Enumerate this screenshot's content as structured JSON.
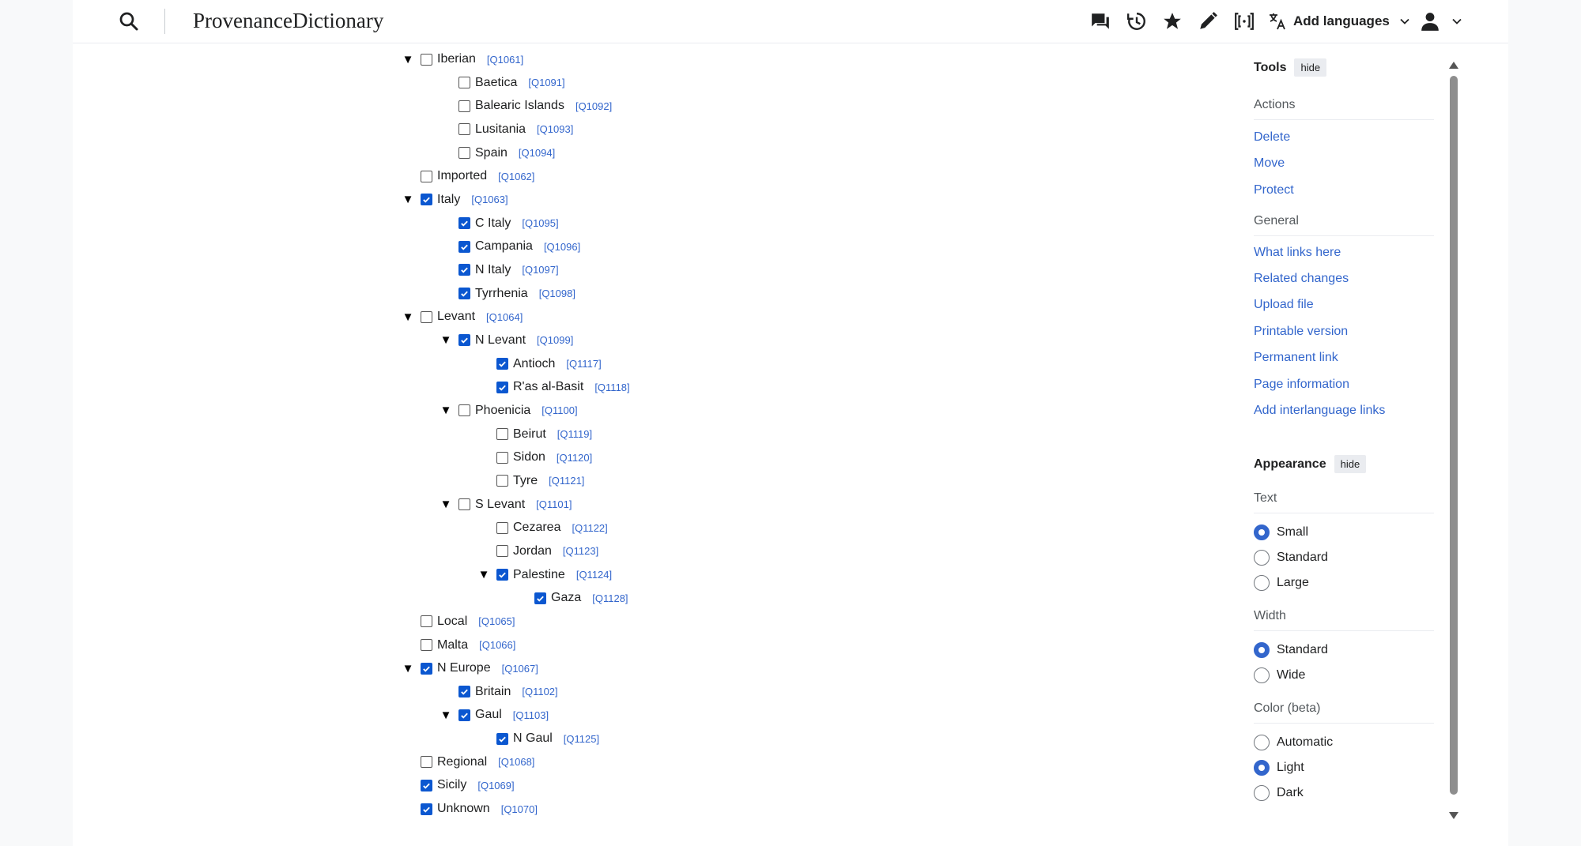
{
  "header": {
    "site_title": "ProvenanceDictionary",
    "add_languages": "Add languages",
    "icons": [
      "search-icon",
      "discussion-icon",
      "history-icon",
      "watch-star-icon",
      "edit-pencil-icon",
      "wikitext-brackets-icon",
      "language-icon",
      "user-icon"
    ]
  },
  "tree": [
    {
      "label": "Iberian",
      "qid": "[Q1061]",
      "checked": false,
      "expanded": true
    },
    {
      "label": "Baetica",
      "qid": "[Q1091]",
      "checked": false
    },
    {
      "label": "Balearic Islands",
      "qid": "[Q1092]",
      "checked": false
    },
    {
      "label": "Lusitania",
      "qid": "[Q1093]",
      "checked": false
    },
    {
      "label": "Spain",
      "qid": "[Q1094]",
      "checked": false
    },
    {
      "label": "Imported",
      "qid": "[Q1062]",
      "checked": false
    },
    {
      "label": "Italy",
      "qid": "[Q1063]",
      "checked": true,
      "expanded": true
    },
    {
      "label": "C Italy",
      "qid": "[Q1095]",
      "checked": true
    },
    {
      "label": "Campania",
      "qid": "[Q1096]",
      "checked": true
    },
    {
      "label": "N Italy",
      "qid": "[Q1097]",
      "checked": true
    },
    {
      "label": "Tyrrhenia",
      "qid": "[Q1098]",
      "checked": true
    },
    {
      "label": "Levant",
      "qid": "[Q1064]",
      "checked": false,
      "expanded": true
    },
    {
      "label": "N Levant",
      "qid": "[Q1099]",
      "checked": true,
      "expanded": true
    },
    {
      "label": "Antioch",
      "qid": "[Q1117]",
      "checked": true
    },
    {
      "label": "R'as al-Basit",
      "qid": "[Q1118]",
      "checked": true
    },
    {
      "label": "Phoenicia",
      "qid": "[Q1100]",
      "checked": false,
      "expanded": true
    },
    {
      "label": "Beirut",
      "qid": "[Q1119]",
      "checked": false
    },
    {
      "label": "Sidon",
      "qid": "[Q1120]",
      "checked": false
    },
    {
      "label": "Tyre",
      "qid": "[Q1121]",
      "checked": false
    },
    {
      "label": "S Levant",
      "qid": "[Q1101]",
      "checked": false,
      "expanded": true
    },
    {
      "label": "Cezarea",
      "qid": "[Q1122]",
      "checked": false
    },
    {
      "label": "Jordan",
      "qid": "[Q1123]",
      "checked": false
    },
    {
      "label": "Palestine",
      "qid": "[Q1124]",
      "checked": true,
      "expanded": true
    },
    {
      "label": "Gaza",
      "qid": "[Q1128]",
      "checked": true
    },
    {
      "label": "Local",
      "qid": "[Q1065]",
      "checked": false
    },
    {
      "label": "Malta",
      "qid": "[Q1066]",
      "checked": false
    },
    {
      "label": "N Europe",
      "qid": "[Q1067]",
      "checked": true,
      "expanded": true
    },
    {
      "label": "Britain",
      "qid": "[Q1102]",
      "checked": true
    },
    {
      "label": "Gaul",
      "qid": "[Q1103]",
      "checked": true,
      "expanded": true
    },
    {
      "label": "N Gaul",
      "qid": "[Q1125]",
      "checked": true
    },
    {
      "label": "Regional",
      "qid": "[Q1068]",
      "checked": false
    },
    {
      "label": "Sicily",
      "qid": "[Q1069]",
      "checked": true
    },
    {
      "label": "Unknown",
      "qid": "[Q1070]",
      "checked": true
    }
  ],
  "tools": {
    "title": "Tools",
    "hide": "hide",
    "actions_label": "Actions",
    "actions": [
      "Delete",
      "Move",
      "Protect"
    ],
    "general_label": "General",
    "general": [
      "What links here",
      "Related changes",
      "Upload file",
      "Printable version",
      "Permanent link",
      "Page information",
      "Add interlanguage links"
    ]
  },
  "appearance": {
    "title": "Appearance",
    "hide": "hide",
    "text_label": "Text",
    "text_options": [
      "Small",
      "Standard",
      "Large"
    ],
    "text_selected": "Small",
    "width_label": "Width",
    "width_options": [
      "Standard",
      "Wide"
    ],
    "width_selected": "Standard",
    "color_label": "Color (beta)",
    "color_options": [
      "Automatic",
      "Light",
      "Dark"
    ],
    "color_selected": "Light"
  },
  "colors": {
    "link": "#3366cc",
    "checkbox_checked": "#0b57d0",
    "radio_selected": "#3366cc"
  }
}
